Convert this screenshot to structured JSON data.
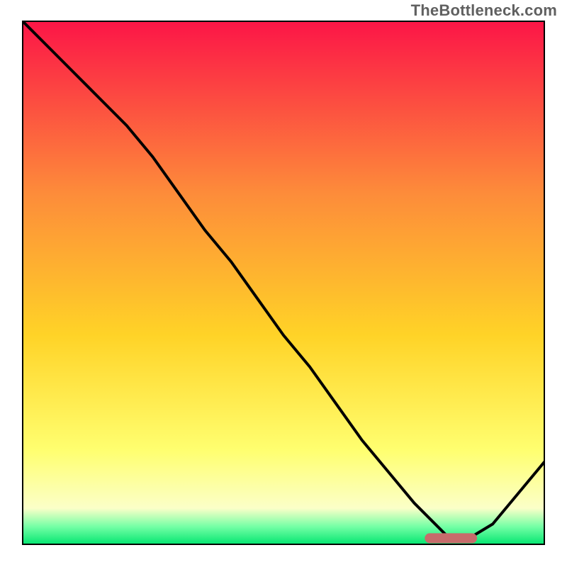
{
  "attribution": "TheBottleneck.com",
  "colors": {
    "gradient_top": "#fc1547",
    "gradient_upper_mid": "#fd8c3a",
    "gradient_mid": "#ffd327",
    "gradient_lower_mid": "#ffff70",
    "gradient_lower": "#fbffc8",
    "gradient_bottom_band": "#74ffa5",
    "gradient_bottom": "#00e56f",
    "frame": "#000000",
    "curve": "#000000",
    "marker": "#c76b6b"
  },
  "chart_data": {
    "type": "line",
    "title": "",
    "xlabel": "",
    "ylabel": "",
    "xlim": [
      0,
      100
    ],
    "ylim": [
      0,
      100
    ],
    "legend": false,
    "grid": false,
    "series": [
      {
        "name": "bottleneck-curve",
        "x": [
          0,
          5,
          10,
          15,
          20,
          25,
          30,
          35,
          40,
          45,
          50,
          55,
          60,
          65,
          70,
          75,
          80,
          82,
          85,
          90,
          95,
          100
        ],
        "y": [
          100,
          95,
          90,
          85,
          80,
          74,
          67,
          60,
          54,
          47,
          40,
          34,
          27,
          20,
          14,
          8,
          3,
          1,
          1,
          4,
          10,
          16
        ]
      }
    ],
    "marker": {
      "name": "optimal-range",
      "shape": "rounded-bar",
      "x_start": 77,
      "x_end": 87,
      "y": 1.3
    }
  }
}
